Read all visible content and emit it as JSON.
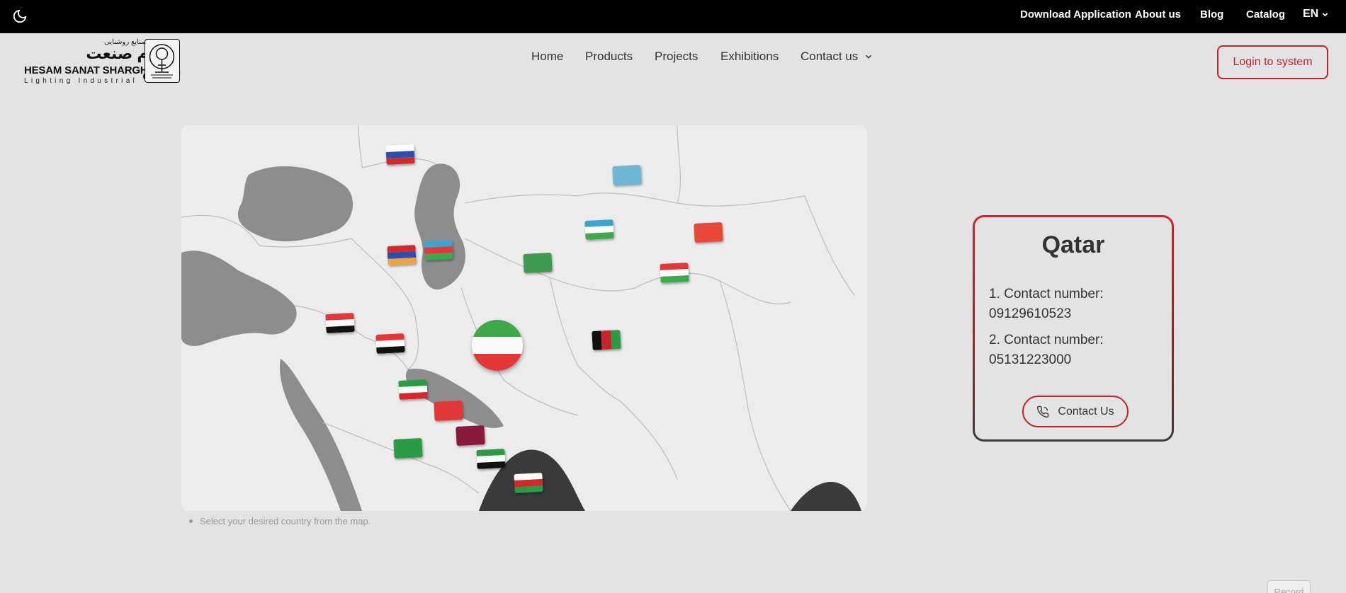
{
  "topbar": {
    "theme_icon": "moon-icon",
    "links": {
      "download": "Download Application",
      "about": "About us",
      "blog": "Blog",
      "catalog": "Catalog",
      "language": "EN"
    }
  },
  "logo": {
    "persian_small": "صنایع روشنایی",
    "persian_name": "حسام صنعت شرق",
    "english_name": "HESAM SANAT SHARGH",
    "subtitle": "Lighting Industrial"
  },
  "nav": {
    "home": "Home",
    "products": "Products",
    "projects": "Projects",
    "exhibitions": "Exhibitions",
    "contact": "Contact us"
  },
  "login_label": "Login to system",
  "map": {
    "hint": "Select your desired country from the map.",
    "flags": [
      "Russia",
      "Kazakhstan",
      "Uzbekistan",
      "Kyrgyzstan",
      "Armenia",
      "Azerbaijan",
      "Turkmenistan",
      "Tajikistan",
      "Syria",
      "Iraq",
      "Iran",
      "Afghanistan",
      "Kuwait",
      "Bahrain",
      "Qatar",
      "Saudi Arabia",
      "UAE",
      "Oman"
    ]
  },
  "card": {
    "country": "Qatar",
    "contact1_label": "1. Contact number:",
    "contact1_value": "09129610523",
    "contact2_label": "2. Contact number:",
    "contact2_value": "05131223000",
    "button_label": "Contact Us"
  },
  "record_label": "Record",
  "colors": {
    "accent": "#c0242b",
    "topbar": "#000000",
    "background": "#e3e3e3"
  }
}
